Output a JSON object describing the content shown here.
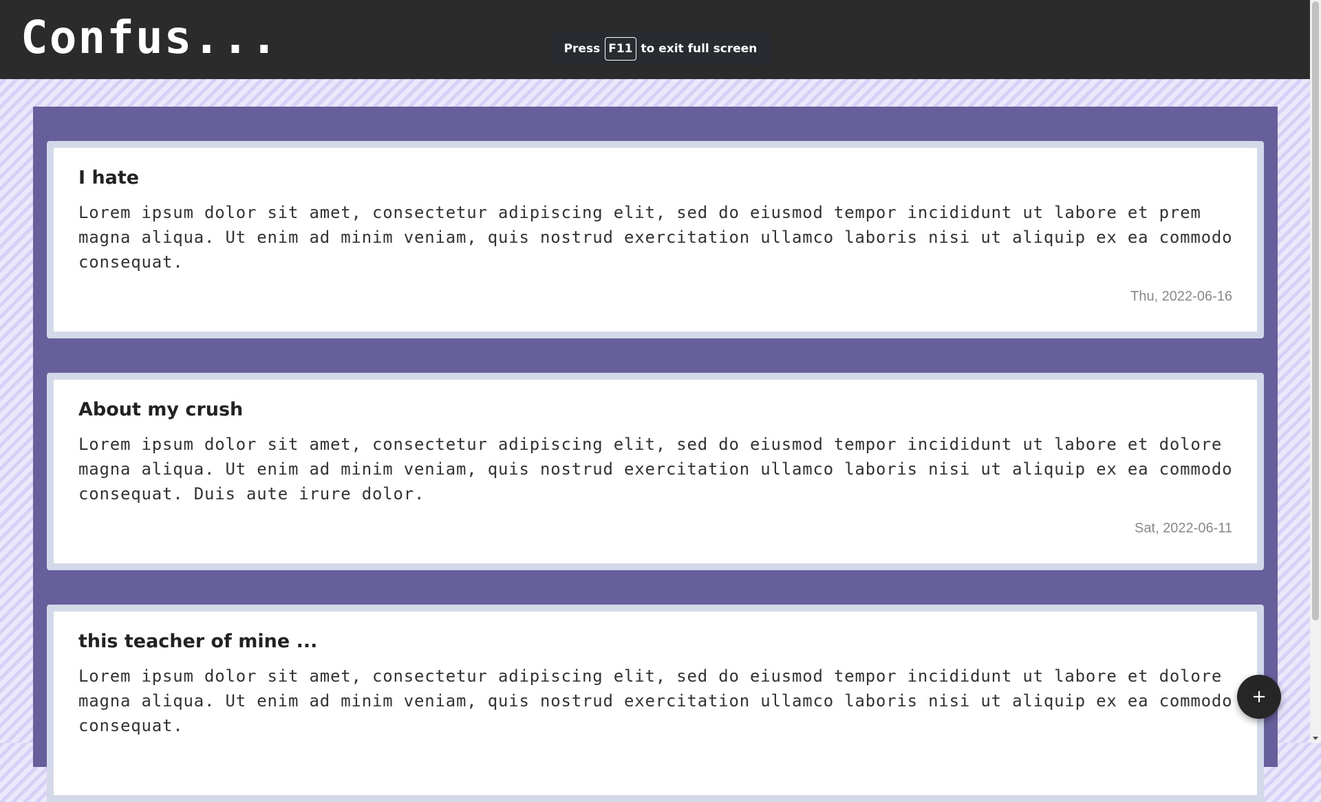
{
  "header": {
    "title": "Confus...",
    "fullscreen_notice": {
      "prefix": "Press",
      "key": "F11",
      "suffix": "to exit full screen"
    }
  },
  "posts": [
    {
      "title": "I hate",
      "body": "Lorem ipsum dolor sit amet, consectetur adipiscing elit, sed do eiusmod tempor incididunt ut labore et prem magna aliqua. Ut enim ad minim veniam, quis nostrud exercitation ullamco laboris nisi ut aliquip ex ea commodo consequat.",
      "date": "Thu, 2022-06-16"
    },
    {
      "title": "About my crush",
      "body": "Lorem ipsum dolor sit amet, consectetur adipiscing elit, sed do eiusmod tempor incididunt ut labore et dolore magna aliqua. Ut enim ad minim veniam, quis nostrud exercitation ullamco laboris nisi ut aliquip ex ea commodo consequat. Duis aute irure dolor.",
      "date": "Sat, 2022-06-11"
    },
    {
      "title": "this teacher of mine ...",
      "body": "Lorem ipsum dolor sit amet, consectetur adipiscing elit, sed do eiusmod tempor incididunt ut labore et dolore magna aliqua. Ut enim ad minim veniam, quis nostrud exercitation ullamco laboris nisi ut aliquip ex ea commodo consequat.",
      "date": ""
    }
  ],
  "fab": {
    "label": "+",
    "icon": "plus-icon"
  },
  "colors": {
    "header_bg": "#2b2b2b",
    "panel_bg": "#675f9c",
    "card_border": "#d3d9e8",
    "page_pattern": "#d6d0f6"
  }
}
